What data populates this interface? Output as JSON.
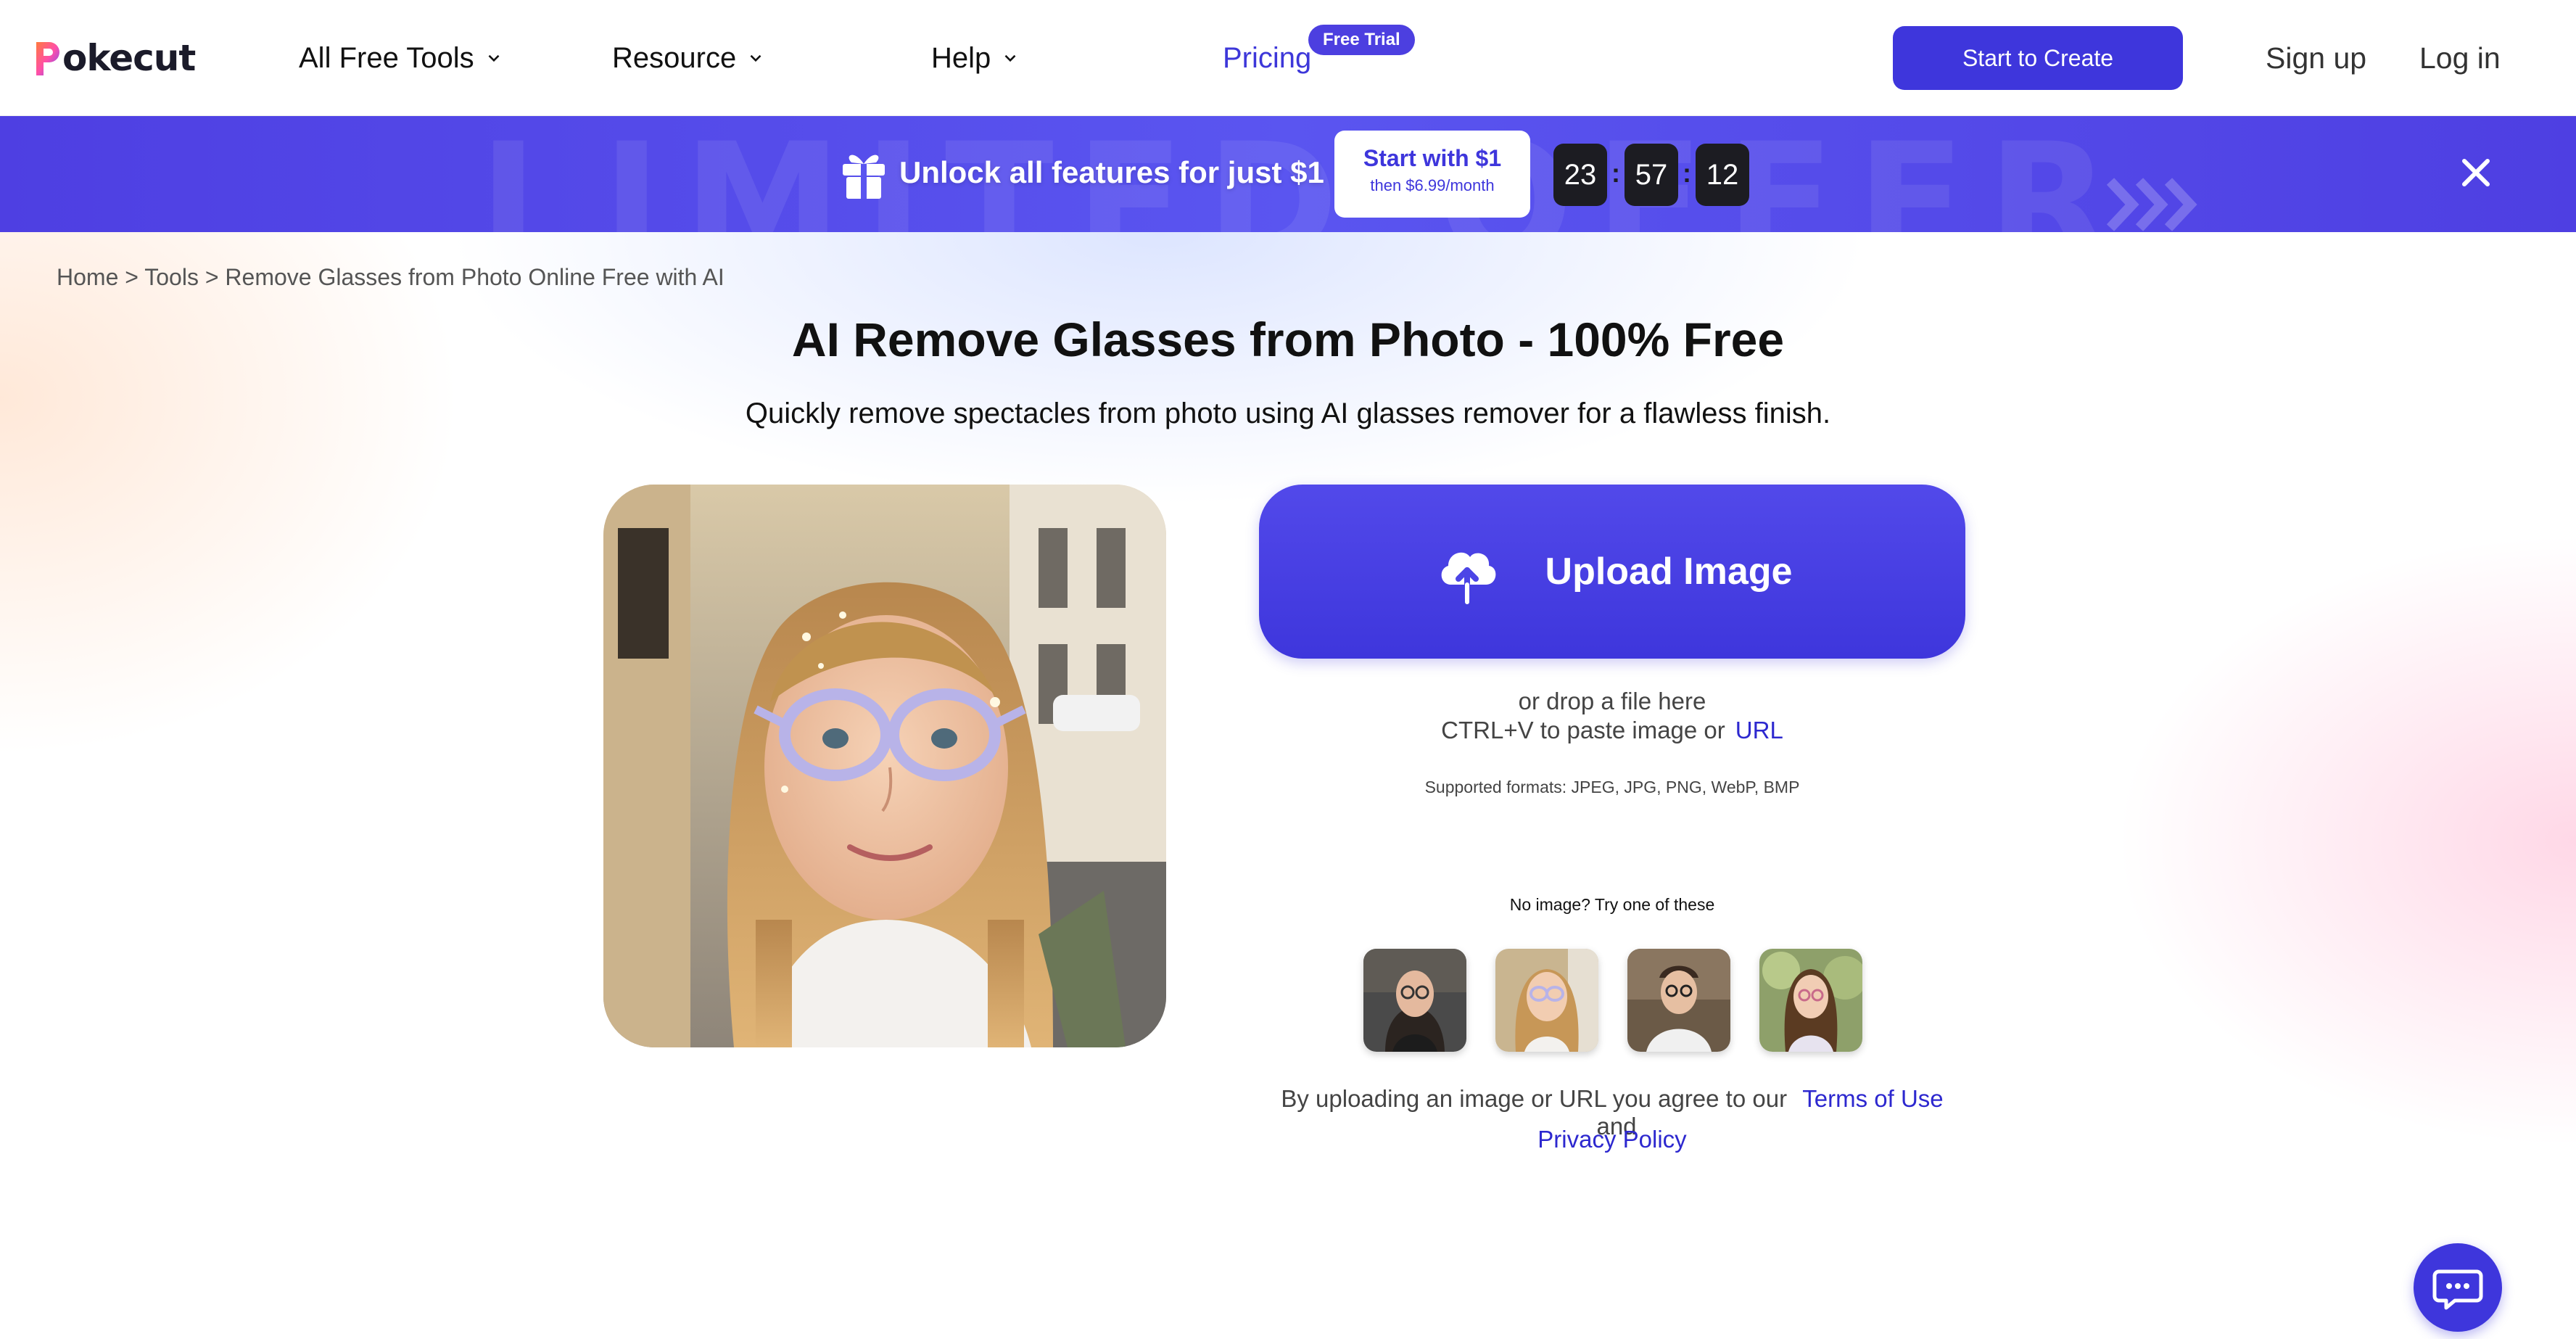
{
  "header": {
    "logo_text": "okecut",
    "logo_letter": "P",
    "nav": {
      "all_free_tools": "All Free Tools",
      "resource": "Resource",
      "help": "Help",
      "pricing": "Pricing",
      "free_trial_badge": "Free Trial"
    },
    "start_to_create": "Start to Create",
    "sign_up": "Sign up",
    "log_in": "Log in"
  },
  "banner": {
    "watermark": "LIMITED OFFER",
    "headline": "Unlock all features for just $1",
    "cta_main": "Start with $1",
    "cta_sub": "then $6.99/month",
    "timer": {
      "hours": "23",
      "minutes": "57",
      "seconds": "12",
      "separator": ":"
    }
  },
  "breadcrumb": "Home > Tools > Remove Glasses from Photo Online Free with AI",
  "main": {
    "title": "AI Remove Glasses from Photo - 100% Free",
    "subtitle": "Quickly remove spectacles from photo using AI glasses remover for a flawless finish.",
    "upload_label": "Upload Image",
    "drop_line1": "or drop a file here",
    "drop_line2": "CTRL+V to paste image or",
    "url_link": "URL",
    "formats": "Supported formats: JPEG, JPG, PNG, WebP, BMP",
    "try_label": "No image? Try one of these",
    "terms_prefix": "By uploading an image or URL you agree to our",
    "terms_link": "Terms of Use",
    "terms_and": "and",
    "privacy_link": "Privacy Policy"
  },
  "colors": {
    "brand": "#3e36dc",
    "banner": "#5249ea",
    "timer_bg": "#1c1c22"
  },
  "icons": [
    "chevron-down-icon",
    "gift-icon",
    "close-icon",
    "cloud-upload-icon",
    "chat-icon"
  ]
}
